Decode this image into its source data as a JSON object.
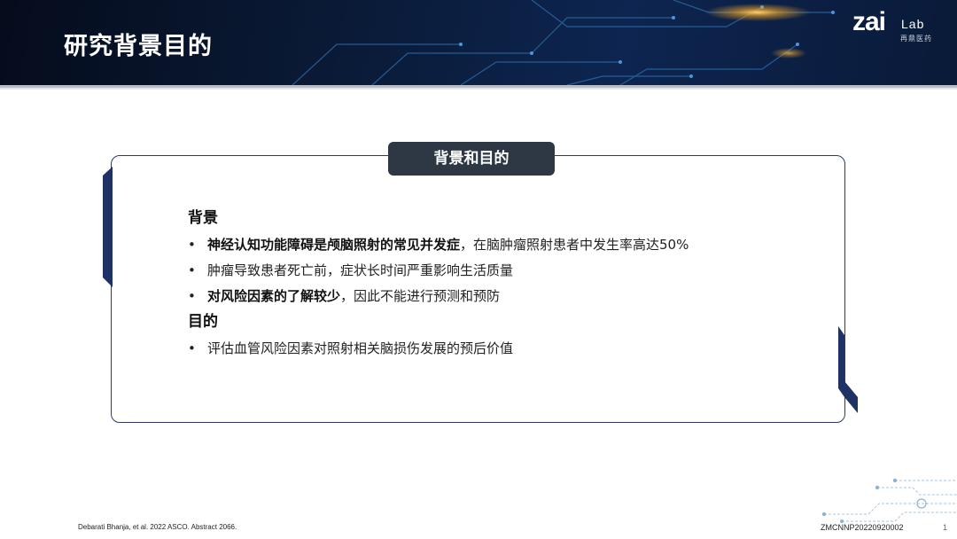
{
  "header": {
    "title": "研究背景目的",
    "logo_main": "zai",
    "logo_lab": "Lab",
    "logo_cn": "再鼎医药"
  },
  "card": {
    "pill_label": "背景和目的",
    "background": {
      "heading": "背景",
      "bullets": [
        {
          "bold": "神经认知功能障碍是颅脑照射的常见并发症",
          "rest": "，在脑肿瘤照射患者中发生率高达50%"
        },
        {
          "bold": "",
          "rest": "肿瘤导致患者死亡前，症状长时间严重影响生活质量"
        },
        {
          "bold": "对风险因素的了解较少",
          "rest": "，因此不能进行预测和预防"
        }
      ]
    },
    "objective": {
      "heading": "目的",
      "bullets": [
        {
          "bold": "",
          "rest": "评估血管风险因素对照射相关脑损伤发展的预后价值"
        }
      ]
    }
  },
  "footer": {
    "citation": "Debarati Bhanja, et al. 2022 ASCO. Abstract 2066.",
    "code": "ZMCNNP20220920002",
    "page": "1"
  },
  "colors": {
    "header_dark": "#0a1a36",
    "frame_border": "#2b3a6a",
    "pill_bg": "#2e3744",
    "accent_orange": "#f5a623"
  }
}
